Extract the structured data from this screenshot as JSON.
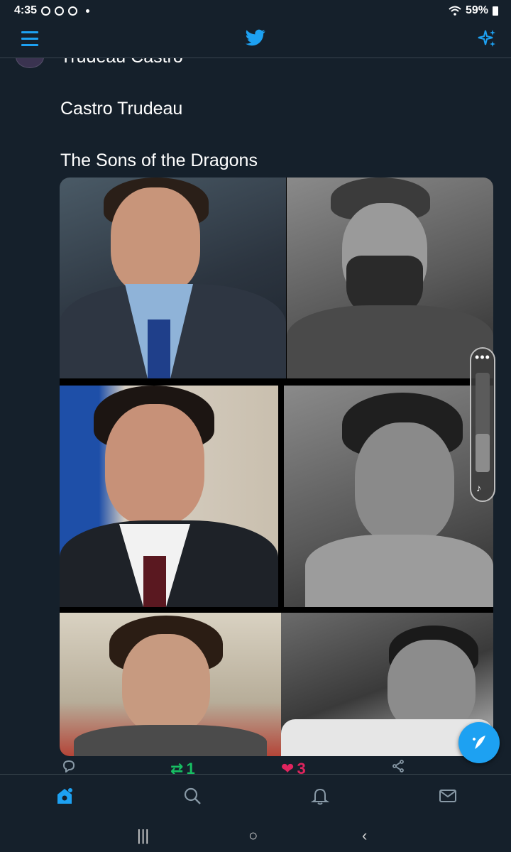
{
  "status_bar": {
    "time": "4:35",
    "battery": "59%"
  },
  "top_bar": {
    "menu_icon": "menu-icon",
    "logo_icon": "twitter-bird-icon",
    "sparkle_icon": "sparkle-icon"
  },
  "tweet": {
    "lines": [
      "Trudeau Castro",
      "Castro Trudeau",
      "The Sons of the Dragons"
    ],
    "media_icon": "photo-grid"
  },
  "actions": {
    "retweets": "1",
    "likes": "3"
  },
  "bottom_nav": [
    "home-icon",
    "search-icon",
    "notifications-icon",
    "messages-icon"
  ],
  "system_nav": {
    "recents": "|||",
    "home": "○",
    "back": "‹"
  },
  "colors": {
    "background": "#15202b",
    "accent": "#1da1f2",
    "retweet": "#17bf63",
    "like": "#e0245e"
  }
}
